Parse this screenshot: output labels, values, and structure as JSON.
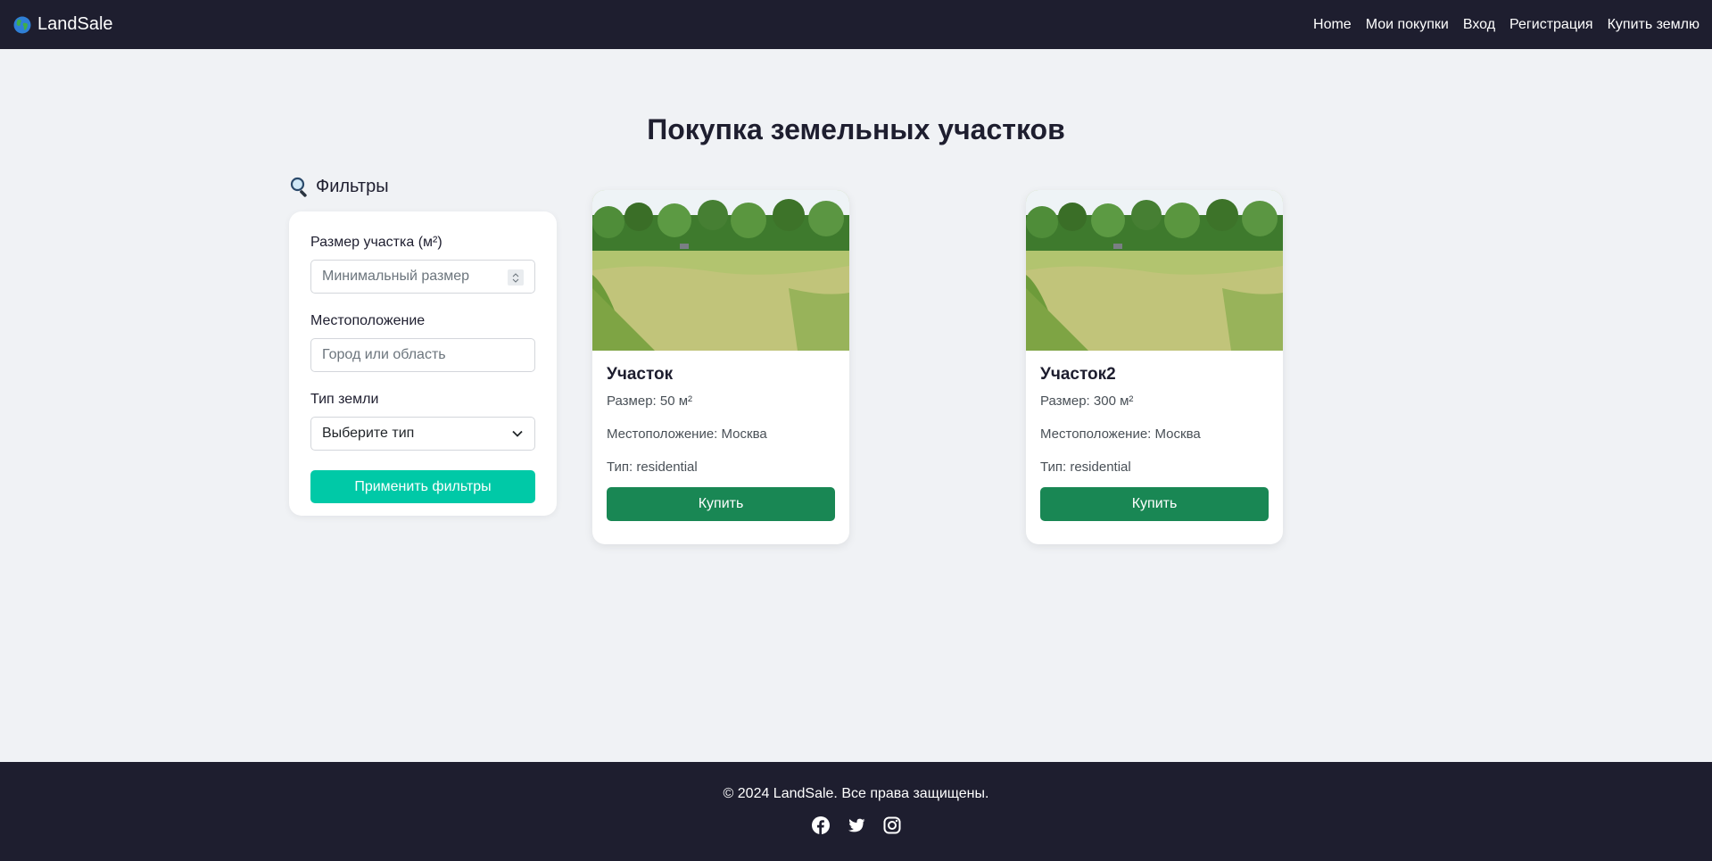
{
  "navbar": {
    "brand": "LandSale",
    "brand_icon": "globe-icon",
    "links": [
      "Home",
      "Мои покупки",
      "Вход",
      "Регистрация",
      "Купить землю"
    ]
  },
  "page": {
    "title": "Покупка земельных участков"
  },
  "filters": {
    "heading": "Фильтры",
    "heading_icon": "magnifier-icon",
    "size_label": "Размер участка (м²)",
    "size_placeholder": "Минимальный размер",
    "location_label": "Местоположение",
    "location_placeholder": "Город или область",
    "type_label": "Тип земли",
    "type_selected": "Выберите тип",
    "apply_label": "Применить фильтры"
  },
  "listings": [
    {
      "title": "Участок",
      "size": "Размер: 50 м²",
      "location": "Местоположение: Москва",
      "type": "Тип: residential",
      "buy_label": "Купить"
    },
    {
      "title": "Участок2",
      "size": "Размер: 300 м²",
      "location": "Местоположение: Москва",
      "type": "Тип: residential",
      "buy_label": "Купить"
    }
  ],
  "footer": {
    "copyright": "© 2024 LandSale. Все права защищены.",
    "socials": [
      "facebook-icon",
      "twitter-icon",
      "instagram-icon"
    ]
  },
  "colors": {
    "navbar_bg": "#1e1e2f",
    "page_bg": "#f0f2f5",
    "apply_button": "#00c9a7",
    "buy_button": "#198754"
  }
}
